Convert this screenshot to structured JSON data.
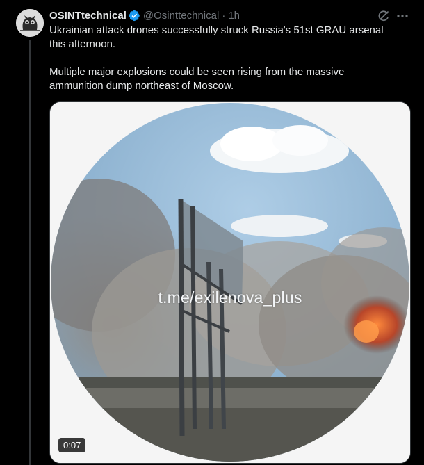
{
  "author": {
    "display_name": "OSINTtechnical",
    "handle": "@Osinttechnical",
    "separator": "·",
    "time": "1h",
    "verified_color": "#1d9bf0"
  },
  "post": {
    "paragraphs": [
      "Ukrainian attack drones successfully struck Russia's 51st GRAU arsenal this afternoon.",
      "Multiple major explosions could be seen rising from the massive ammunition dump northeast of Moscow."
    ]
  },
  "media": {
    "type": "video",
    "watermark": "t.me/exilenova_plus",
    "duration": "0:07"
  },
  "icons": {
    "grok": "grok-icon",
    "more": "more-icon",
    "verified": "verified-badge-icon"
  },
  "colors": {
    "background": "#000000",
    "text": "#e7e9ea",
    "secondary": "#71767b",
    "border": "#2f3336"
  }
}
